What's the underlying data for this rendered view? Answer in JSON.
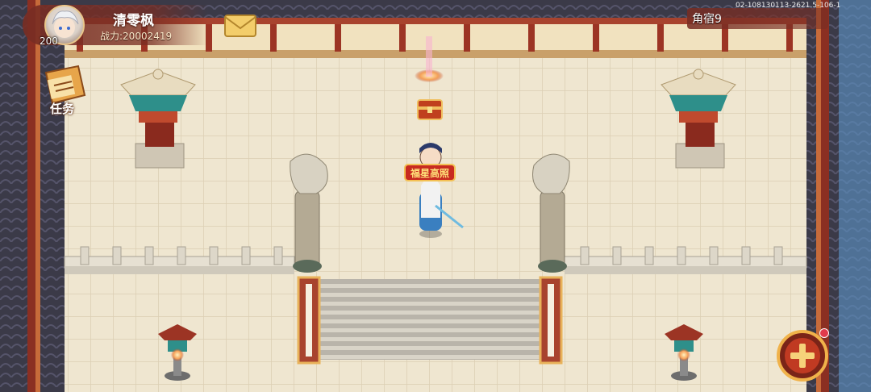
{
  "player": {
    "name": "清零枫",
    "level": "200",
    "power": "战力:20002419"
  },
  "quest_button": {
    "label": "任务"
  },
  "map": {
    "name": "角宿9",
    "coords_text": "02-108130113-2621.5-106-1"
  },
  "character_title": "福星高照",
  "colors": {
    "floor": "#efe6d0",
    "floor_grid": "#d8ccb0",
    "wall_dark": "#3b3a48",
    "wood_red": "#9c3424",
    "gold": "#e8b25a",
    "hud_panel": "#7a2d23"
  },
  "icons": [
    "mail-icon",
    "scroll-icon",
    "plus-icon",
    "treasure-chest-icon"
  ]
}
